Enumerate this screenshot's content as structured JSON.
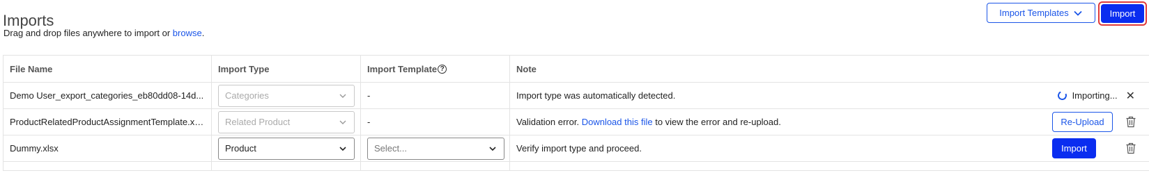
{
  "header": {
    "title": "Imports",
    "subtitle_prefix": "Drag and drop files anywhere to import or ",
    "subtitle_link": "browse",
    "subtitle_suffix": ".",
    "templates_button": "Import Templates",
    "import_button": "Import"
  },
  "table": {
    "columns": [
      "File Name",
      "Import Type",
      "Import Template",
      "Note"
    ],
    "rows": [
      {
        "file_name": "Demo User_export_categories_eb80dd08-14d...",
        "import_type": "Categories",
        "import_template": "-",
        "note": "Import type was automatically detected.",
        "status": "Importing..."
      },
      {
        "file_name": "ProductRelatedProductAssignmentTemplate.xlsx",
        "import_type": "Related Product",
        "import_template": "-",
        "note_prefix": "Validation error. ",
        "note_link": "Download this file",
        "note_suffix": " to view the error and re-upload.",
        "action": "Re-Upload"
      },
      {
        "file_name": "Dummy.xlsx",
        "import_type": "Product",
        "import_template_placeholder": "Select...",
        "note": "Verify import type and proceed.",
        "action": "Import"
      }
    ]
  },
  "icons": {
    "chevron": "chevron-down-icon",
    "help": "help-circle-icon",
    "spinner": "spinner-icon",
    "close": "close-icon",
    "trash": "trash-icon"
  },
  "colors": {
    "accent": "#1a55e8",
    "primary_button": "#0a2df0",
    "highlight_border": "#e03a3a"
  }
}
